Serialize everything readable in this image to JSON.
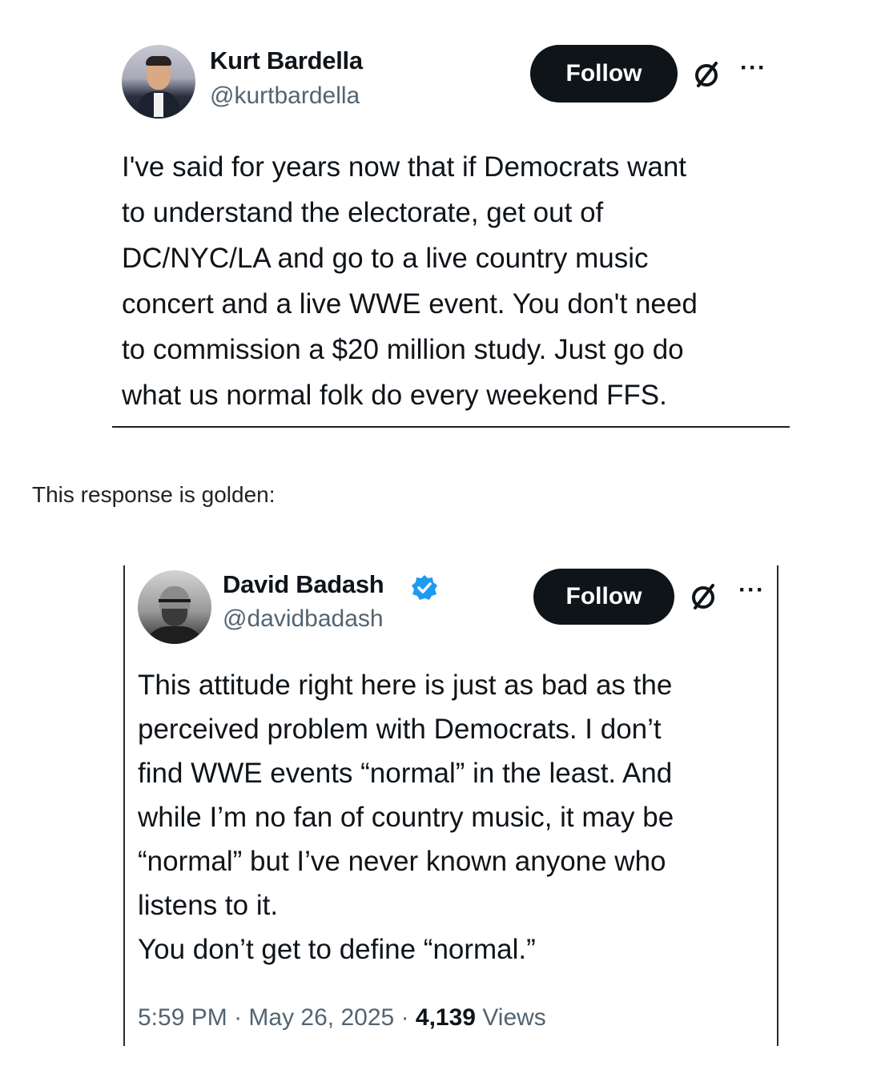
{
  "tweet1": {
    "author_name": "Kurt Bardella",
    "handle": "@kurtbardella",
    "follow_label": "Follow",
    "more_label": "···",
    "text": "I've said for years now that if Democrats want\nto understand the electorate, get out of\nDC/NYC/LA and go to a live country music\nconcert and a live WWE event. You don't need\nto commission a $20 million study. Just go do\nwhat us normal folk do every weekend FFS."
  },
  "caption": "This response is golden:",
  "tweet2": {
    "author_name": "David Badash",
    "handle": "@davidbadash",
    "verified": true,
    "follow_label": "Follow",
    "more_label": "···",
    "text": "This attitude right here is just as bad as the\nperceived problem with Democrats. I don’t\nfind WWE events “normal” in the least. And\nwhile I’m no fan of country music, it may be\n“normal” but I’ve never known anyone who\nlistens to it.\nYou don’t get to define “normal.”",
    "time": "5:59 PM",
    "separator": "·",
    "date": "May 26, 2025",
    "views_count": "4,139",
    "views_label": "Views"
  },
  "colors": {
    "button_bg": "#0f1419",
    "secondary_text": "#536471",
    "verified_blue": "#1d9bf0"
  },
  "icons": {
    "null_icon": "circle-slash-icon",
    "more_icon": "more-dots-icon",
    "verified_icon": "verified-badge-icon"
  }
}
